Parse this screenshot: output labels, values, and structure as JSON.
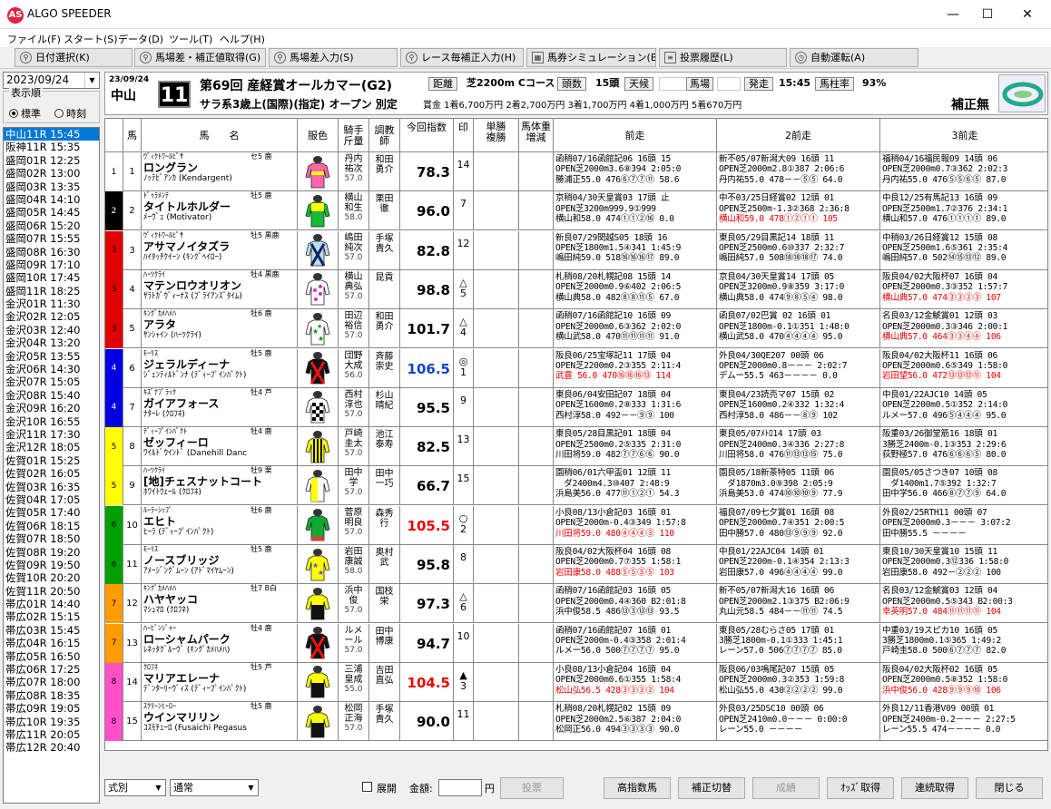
{
  "app": {
    "title": "ALGO SPEEDER",
    "icon": "AS"
  },
  "window": {
    "minimize": "—",
    "maximize": "☐",
    "close": "✕"
  },
  "menu": [
    "ファイル(F)",
    "スタート(S)",
    "データ(D)",
    "ツール(T)",
    "ヘルプ(H)"
  ],
  "toolbar": [
    {
      "label": "日付選択(K)",
      "icon": "search-icon"
    },
    {
      "label": "馬場差・補正値取得(G)",
      "icon": "search-icon"
    },
    {
      "label": "馬場差入力(S)",
      "icon": "search-icon"
    },
    {
      "label": "レース毎補正入力(H)",
      "icon": "search-icon"
    },
    {
      "label": "馬券シミュレーション(B)",
      "icon": "grid-icon"
    },
    {
      "label": "投票履歴(L)",
      "icon": "document-icon"
    },
    {
      "label": "自動運転(A)",
      "icon": "clock-icon"
    }
  ],
  "sidebar": {
    "date": "2023/09/24",
    "display_order_label": "表示順",
    "radio_standard": "標準",
    "radio_time": "時刻",
    "races": [
      "中山11R 15:45",
      "阪神11R 15:35",
      "盛岡01R 12:25",
      "盛岡02R 13:00",
      "盛岡03R 13:35",
      "盛岡04R 14:10",
      "盛岡05R 14:45",
      "盛岡06R 15:20",
      "盛岡07R 15:55",
      "盛岡08R 16:30",
      "盛岡09R 17:10",
      "盛岡10R 17:45",
      "盛岡11R 18:25",
      "金沢01R 11:30",
      "金沢02R 12:05",
      "金沢03R 12:40",
      "金沢04R 13:20",
      "金沢05R 13:55",
      "金沢06R 14:30",
      "金沢07R 15:05",
      "金沢08R 15:40",
      "金沢09R 16:20",
      "金沢10R 16:55",
      "金沢11R 17:30",
      "金沢12R 18:05",
      "佐賀01R 15:25",
      "佐賀02R 16:05",
      "佐賀03R 16:35",
      "佐賀04R 17:05",
      "佐賀05R 17:40",
      "佐賀06R 18:15",
      "佐賀07R 18:50",
      "佐賀08R 19:20",
      "佐賀09R 19:50",
      "佐賀10R 20:20",
      "佐賀11R 20:50",
      "帯広01R 14:40",
      "帯広02R 15:15",
      "帯広03R 15:45",
      "帯広04R 16:15",
      "帯広05R 16:50",
      "帯広06R 17:25",
      "帯広07R 18:00",
      "帯広08R 18:35",
      "帯広09R 19:05",
      "帯広10R 19:35",
      "帯広11R 20:05",
      "帯広12R 20:40"
    ]
  },
  "race": {
    "date": "23/09/24",
    "venue": "中山",
    "race_no": "11",
    "name": "第69回 産経賞オールカマー(G2)",
    "class": "サラ系3歳上(国際)(指定) オープン 別定",
    "dist_label": "距離",
    "dist_value": "芝2200m Cコース",
    "heads_label": "頭数",
    "heads_value": "15頭",
    "weather_label": "天候",
    "weather_value": "",
    "track_label": "馬場",
    "track_value": "",
    "post_label": "発走",
    "post_value": "15:45",
    "odds_rate_label": "馬柱率",
    "odds_rate_value": "93%",
    "prize": "賞金 1着6,700万円 2着2,700万円 3着1,700万円 4着1,000万円 5着670万円",
    "correction": "補正無"
  },
  "table_headers": {
    "uma": "馬",
    "name": "馬　　名",
    "silk": "服色",
    "jockey": "騎手\n斤量",
    "trainer": "調教\n師",
    "index": "今回指数",
    "mark": "印",
    "odds": "単勝\n複勝",
    "weight": "馬体重\n増減",
    "p1": "前走",
    "p2": "2前走",
    "p3": "3前走"
  },
  "horses": [
    {
      "waku": "1",
      "num": "1",
      "sire": "ｳﾞｨｸﾄﾜｰﾙﾋﾟｻ",
      "sex": "セ5 鹿",
      "name": "ロングラン",
      "dam": "ﾉｯﾃﾋﾞｱﾝｶ (Kendargent)",
      "jockey": "丹内\n祐次",
      "weight": "57.0",
      "trainer": "和田\n勇介",
      "index": "78.3",
      "index_color": "black",
      "mark": "",
      "mark_num": "14",
      "silk": "pink-yellow",
      "p1": [
        "函稍07/16函館記06 16頭 15",
        "OPEN芝2000m3.6⑧394 2:05:0",
        "勝浦正55.0 476⑥⑦⑦⑪ 58.6"
      ],
      "p1_red": false,
      "p2": [
        "新不05/07新潟大09 16頭 11",
        "OPEN芝2000m2.8①387 2:06:6",
        "丹内祐55.0 478－－⑤⑤ 64.0"
      ],
      "p2_red": false,
      "p3": [
        "福稍04/16福民報09 14頭 06",
        "OPEN芝2000m0.7③362 2:02:3",
        "丹内祐55.0 476⑤⑤⑥⑤ 87.0"
      ],
      "p3_red": false
    },
    {
      "waku": "2",
      "num": "2",
      "sire": "ﾄﾞｩﾗﾒﾝﾃ",
      "sex": "牡5 鹿",
      "name": "タイトルホルダー",
      "dam": "ﾒｰｳﾞｪ (Motivator)",
      "jockey": "横山\n和生",
      "weight": "58.0",
      "trainer": "栗田\n徹",
      "index": "96.0",
      "index_color": "black",
      "mark": "",
      "mark_num": "7",
      "silk": "green-yellow",
      "p1": [
        "京稍04/30天皇賞03 17頭 止",
        "OPEN芝3200m999.9①999",
        "横山和58.0 474①①②⑯ 0.0"
      ],
      "p1_red": false,
      "p2": [
        "中不03/25日経賞02 12頭 01",
        "OPEN芝2500m-1.3②368 2:36:8",
        "横山和59.0 478①②①① 105"
      ],
      "p2_red": true,
      "p3": [
        "中良12/25有馬記13 16頭 09",
        "OPEN芝2500m1.7②376 2:34:1",
        "横山和57.0 476①①①① 89.0"
      ],
      "p3_red": false
    },
    {
      "waku": "3",
      "num": "3",
      "sire": "ｳﾞｨｸﾄﾜｰﾙﾋﾟｻ",
      "sex": "牡5 黒鹿",
      "name": "アサマノイタズラ",
      "dam": "ﾊｲﾀｯﾁｸｲｰﾝ (ｷﾝｸﾞﾍｲﾛｰ)",
      "jockey": "嶋田\n純次",
      "weight": "57.0",
      "trainer": "手塚\n貴久",
      "index": "82.8",
      "index_color": "black",
      "mark": "",
      "mark_num": "12",
      "silk": "cross-blue",
      "p1": [
        "新良07/29関越S05 18頭 16",
        "OPEN芝1800m1.5④341 1:45:9",
        "嶋田純59.0 518⑯⑯⑯⑰ 89.0"
      ],
      "p1_red": false,
      "p2": [
        "東良05/29目黒記14 18頭 11",
        "OPEN芝2500m0.6⑩337 2:32:7",
        "嶋田純57.0 508⑱⑱⑱⑰ 74.0"
      ],
      "p2_red": false,
      "p3": [
        "中稍03/26日経賞12 15頭 08",
        "OPEN芝2500m1.6⑤361 2:35:4",
        "嶋田純57.0 502⑭⑮⑬⑫ 89.0"
      ],
      "p3_red": false
    },
    {
      "waku": "3",
      "num": "4",
      "sire": "ﾊｰﾂｸﾗｲ",
      "sex": "牡4 黒鹿",
      "name": "マテンロウオリオン",
      "dam": "ｻﾗﾄｶﾞｳﾞｨｰﾅｽ (ﾌﾞﾗｲｱﾝｽﾞﾀｲﾑ)",
      "jockey": "横山\n典弘",
      "weight": "57.0",
      "trainer": "昆貢",
      "index": "98.8",
      "index_color": "black",
      "mark": "△",
      "mark_num": "5",
      "silk": "pink-dots",
      "p1": [
        "札稍08/20札幌記08 15頭 14",
        "OPEN芝2000m0.9⑥402 2:06:5",
        "横山典58.0 482⑧⑧⑪⑤ 67.0"
      ],
      "p1_red": false,
      "p2": [
        "京良04/30天皇賞14 17頭 05",
        "OPEN芝3200m0.9⑧359 3:17:0",
        "横山典58.0 474⑨⑧⑤④ 98.0"
      ],
      "p2_red": false,
      "p3": [
        "阪良04/02大阪杯07 16頭 04",
        "OPEN芝2000m0.3③352 1:57:7",
        "横山典57.0 474③③③③ 107"
      ],
      "p3_red": true
    },
    {
      "waku": "3",
      "num": "5",
      "sire": "ｷﾝｸﾞｶﾒﾊﾒﾊ",
      "sex": "牡6 鹿",
      "name": "アラタ",
      "dam": "ｻﾝｼｬｲﾝ (ﾊｰﾂｸﾗｲ)",
      "jockey": "田辺\n裕信",
      "weight": "57.0",
      "trainer": "和田\n勇介",
      "index": "101.7",
      "index_color": "black",
      "mark": "△",
      "mark_num": "4",
      "silk": "green-stars",
      "p1": [
        "函稍07/16函館記10 16頭 09",
        "OPEN芝2000m0.6③362 2:02:0",
        "横山武58.0 470⑪⑪⑪⑪ 91.0"
      ],
      "p1_red": false,
      "p2": [
        "函良07/02巴賞 02 16頭 01",
        "OPEN芝1800m-0.1①351 1:48:0",
        "横山武58.0 470④④④④ 95.0"
      ],
      "p2_red": false,
      "p3": [
        "名良03/12金鯱賞01 12頭 03",
        "OPEN芝2000m0.3③346 2:00:1",
        "横山典57.0 464③③④④ 106"
      ],
      "p3_red": true
    },
    {
      "waku": "4",
      "num": "6",
      "sire": "ﾓｰﾘｽ",
      "sex": "牡5 鹿",
      "name": "ジェラルディーナ",
      "dam": "ｼﾞｪﾝﾃｨﾙﾄﾞﾝﾅ (ﾃﾞｨｰﾌﾟｲﾝﾊﾟｸﾄ)",
      "jockey": "団野\n大成",
      "weight": "56.0",
      "trainer": "斉藤\n崇史",
      "index": "106.5",
      "index_color": "blue",
      "mark": "◎",
      "mark_num": "1",
      "silk": "black-red",
      "p1": [
        "阪良06/25宝塚記11 17頭 04",
        "OPEN芝2200m0.2③355 2:11:4",
        "武豊 56.0 470⑯⑯⑯⑬ 114"
      ],
      "p1_red": true,
      "p2": [
        "外良04/30QE207 00頭 06",
        "OPEN芝2000m0.8－－－ 2:02:7",
        "デムー55.5 463－－－－ 0.0"
      ],
      "p2_red": false,
      "p3": [
        "阪良04/02大阪杯11 16頭 06",
        "OPEN芝2000m0.6⑤349 1:58:0",
        "岩田望56.0 472⑬⑬⑬⑪ 104"
      ],
      "p3_red": true
    },
    {
      "waku": "4",
      "num": "7",
      "sire": "ｷｽﾞﾅﾌﾞﾗｯｸ",
      "sex": "牡4 芦",
      "name": "ガイアフォース",
      "dam": "ﾅﾀｰﾚ (ｸﾛﾌﾈ)",
      "jockey": "西村\n淳也",
      "weight": "57.0",
      "trainer": "杉山\n晴紀",
      "index": "95.5",
      "index_color": "black",
      "mark": "",
      "mark_num": "9",
      "silk": "checker",
      "p1": [
        "東良06/04安田記07 18頭 04",
        "OPEN芝1600m0.2⑧333 1:31:6",
        "西村淳58.0 492－－⑨⑨ 100"
      ],
      "p1_red": false,
      "p2": [
        "東良04/23読売マ07 15頭 02",
        "OPEN芝1600m0.2④332 1:32:4",
        "西村淳58.0 486－－⑧⑨ 102"
      ],
      "p2_red": false,
      "p3": [
        "中良01/22AJC10 14頭 05",
        "OPEN芝2200m0.5①352 2:14:0",
        "ルメー57.0 496⑤④④④ 95.0"
      ],
      "p3_red": false
    },
    {
      "waku": "5",
      "num": "8",
      "sire": "ﾃﾞｨｰﾌﾟｲﾝﾊﾟｸﾄ",
      "sex": "牡4 鹿",
      "name": "ゼッフィーロ",
      "dam": "ﾜｲﾙﾄﾞｳｲﾝﾄﾞ (Danehill Danc",
      "jockey": "戸崎\n圭太",
      "weight": "57.0",
      "trainer": "池江\n泰寿",
      "index": "82.5",
      "index_color": "black",
      "mark": "",
      "mark_num": "13",
      "silk": "yellow-stripe",
      "p1": [
        "東良05/28目黒記01 18頭 04",
        "OPEN芝2500m0.2⑤335 2:31:0",
        "川田将59.0 482⑦⑦⑥⑥ 90.0"
      ],
      "p1_red": false,
      "p2": [
        "東良05/07ﾒﾄﾛ14 17頭 03",
        "OPEN芝2400m0.3④336 2:27:8",
        "川田将58.0 476⑪⑬⑬⑮ 75.0"
      ],
      "p2_red": false,
      "p3": [
        "阪重03/26御堂筋16 18頭 01",
        "3勝芝2400m-0.1③353 2:29:6",
        "荻野極57.0 476⑥⑥⑥⑤ 80.0"
      ],
      "p3_red": false
    },
    {
      "waku": "5",
      "num": "9",
      "sire": "ﾊｰﾂｸﾗｲ",
      "sex": "牡9 栗",
      "name": "[地]チェスナットコート",
      "dam": "ﾎﾜｲﾄｳｪｰﾙ (ｸﾛﾌﾈ)",
      "jockey": "田中\n学",
      "weight": "57.0",
      "trainer": "田中\n一巧",
      "index": "66.7",
      "index_color": "black",
      "mark": "",
      "mark_num": "15",
      "silk": "yellow-white",
      "p1": [
        "園稍06/01六甲盃01 12頭 11",
        "　ダ2400m4.3⑩407 2:48:9",
        "浜島美56.0 477⑪①②① 54.3"
      ],
      "p1_red": false,
      "p2": [
        "園良05/18新茶特05 11頭 06",
        "　ダ1870m3.0⑨398 2:05:9",
        "浜島美53.0 474⑩⑩⑩⑨ 77.9"
      ],
      "p2_red": false,
      "p3": [
        "園良05/05さつき07 10頭 08",
        "　ダ1400m1.7⑤392 1:32:7",
        "田中学56.0 466⑧⑦⑦⑨ 64.0"
      ],
      "p3_red": false
    },
    {
      "waku": "6",
      "num": "10",
      "sire": "ﾙｰﾗｰｼｯﾌﾟ",
      "sex": "牡6 鹿",
      "name": "エヒト",
      "dam": "ﾋｰﾗ (ﾃﾞｨｰﾌﾟｲﾝﾊﾟｸﾄ)",
      "jockey": "菅原\n明良",
      "weight": "57.0",
      "trainer": "森秀\n行",
      "index": "105.5",
      "index_color": "red",
      "mark": "○",
      "mark_num": "2",
      "silk": "green-plain",
      "p1": [
        "小良08/13小倉記03 16頭 01",
        "OPEN芝2000m-0.4③349 1:57:8",
        "川田将59.0 480④④④③ 110"
      ],
      "p1_red": true,
      "p2": [
        "福良07/09七夕賞01 16頭 08",
        "OPEN芝2000m0.7④351 2:00:5",
        "田中勝57.0 480⑬⑨⑨⑨ 92.0"
      ],
      "p2_red": false,
      "p3": [
        "外良02/25RTH11 00頭 07",
        "OPEN芝2000m0.3－－－ 3:07:2",
        "田中勝55.5 －－－－"
      ],
      "p3_red": false
    },
    {
      "waku": "6",
      "num": "11",
      "sire": "ﾓｰﾘｽ",
      "sex": "牡5 鹿",
      "name": "ノースブリッジ",
      "dam": "ｱﾒｰｼﾞﾝｸﾞﾑｰﾝ (ｱﾄﾞﾏｲﾔﾑｰﾝ)",
      "jockey": "岩田\n康誠",
      "weight": "58.0",
      "trainer": "奥村\n武",
      "index": "95.8",
      "index_color": "black",
      "mark": "",
      "mark_num": "8",
      "silk": "purple-yellow",
      "p1": [
        "阪良04/02大阪杯04 16頭 08",
        "OPEN芝2000m0.7⑦355 1:58:1",
        "岩田康58.0 488⑤⑤⑤⑤ 103"
      ],
      "p1_red": true,
      "p2": [
        "中良01/22AJC04 14頭 01",
        "OPEN芝2200m-0.1④354 2:13:3",
        "岩田康57.0 496④④④④ 99.0"
      ],
      "p2_red": false,
      "p3": [
        "東良10/30天皇賞10 15頭 11",
        "OPEN芝2000m0.3⑫336 1:58:0",
        "岩田康58.0 492－②②② 100"
      ],
      "p3_red": false
    },
    {
      "waku": "7",
      "num": "12",
      "sire": "ｷﾝｸﾞｶﾒﾊﾒﾊ",
      "sex": "牡7 B白",
      "name": "ハヤヤッコ",
      "dam": "ﾏｼｭﾏﾛ (ｸﾛﾌﾈ)",
      "jockey": "浜中\n俊",
      "weight": "57.0",
      "trainer": "国枝\n栄",
      "index": "97.3",
      "index_color": "black",
      "mark": "△",
      "mark_num": "6",
      "silk": "yellow-black",
      "p1": [
        "函稍07/16函館記03 16頭 05",
        "OPEN芝2000m0.4④360 B2:01:8",
        "浜中俊58.5 486⑬③⑬⑬ 93.5"
      ],
      "p1_red": false,
      "p2": [
        "新不05/07新潟大16 16頭 06",
        "OPEN芝2000m2.1③375 B2:06:9",
        "丸山元58.5 484－－⑪⑪ 74.5"
      ],
      "p2_red": false,
      "p3": [
        "名良03/12金鯱賞03 12頭 04",
        "OPEN芝2000m0.5⑤343 B2:00:3",
        "幸英明57.0 484⑪⑪⑪⑪ 104"
      ],
      "p3_red": true
    },
    {
      "waku": "7",
      "num": "13",
      "sire": "ﾊｰﾋﾞﾝｼﾞｬｰ",
      "sex": "牡4 鹿",
      "name": "ローシャムパーク",
      "dam": "ﾚﾈｯﾀｸﾞﾙｰｳﾞ (ｷﾝｸﾞｶﾒﾊﾒﾊ)",
      "jockey": "ルメ\nール",
      "weight": "57.0",
      "trainer": "田中\n博康",
      "index": "94.7",
      "index_color": "black",
      "mark": "",
      "mark_num": "10",
      "silk": "black-red",
      "p1": [
        "函稍07/16函館記07 16頭 01",
        "OPEN芝2000m-0.4③358 2:01:4",
        "ルメー56.0 500⑦⑦⑦⑦ 95.0"
      ],
      "p1_red": false,
      "p2": [
        "東良05/28むらさ05 17頭 01",
        "3勝芝1800m-0.1①333 1:45:1",
        "レーン57.0 506⑦⑦⑦⑦ 85.0"
      ],
      "p2_red": false,
      "p3": [
        "中重03/19スピカ10 16頭 05",
        "3勝芝1800m0.1⑤365 1:49:2",
        "戸崎圭58.0 500⑥⑦⑦⑦ 82.0"
      ],
      "p3_red": false
    },
    {
      "waku": "8",
      "num": "14",
      "sire": "ｸﾛﾌﾈ",
      "sex": "牡5 芦",
      "name": "マリアエレーナ",
      "dam": "ﾃﾞﾝﾀｰﾘｰｳﾞｨｽ (ﾃﾞｨｰﾌﾟｲﾝﾊﾟｸﾄ)",
      "jockey": "三浦\n皇成",
      "weight": "55.0",
      "trainer": "吉田\n直弘",
      "index": "104.5",
      "index_color": "red",
      "mark": "▲",
      "mark_num": "3",
      "silk": "yellow-black",
      "p1": [
        "小良08/13小倉記04 16頭 04",
        "OPEN芝2000m0.6①355 1:58:4",
        "松山弘56.5 428③③③② 104"
      ],
      "p1_red": true,
      "p2": [
        "阪良06/03鳴尾記07 15頭 05",
        "OPEN芝2000m0.3②353 1:59:8",
        "松山弘55.0 430②②②② 99.0"
      ],
      "p2_red": false,
      "p3": [
        "阪良04/02大阪杯02 16頭 05",
        "OPEN芝2000m0.5⑧352 1:58:0",
        "浜中俊56.0 428⑨⑨⑨⑩ 106"
      ],
      "p3_red": true
    },
    {
      "waku": "8",
      "num": "15",
      "sire": "ｽｸﾘｰﾝﾋｰﾛｰ",
      "sex": "牡5 鹿",
      "name": "ウインマリリン",
      "dam": "ｺｽﾓﾁｪｰﾛ (Fusaichi Pegasus",
      "jockey": "松岡\n正海",
      "weight": "57.0",
      "trainer": "手塚\n貴久",
      "index": "90.0",
      "index_color": "black",
      "mark": "",
      "mark_num": "11",
      "silk": "yellow-black",
      "p1": [
        "札稍08/20札幌記02 15頭 09",
        "OPEN芝2000m2.5⑥387 2:04:0",
        "松岡正56.0 494③③③③ 90.0"
      ],
      "p1_red": false,
      "p2": [
        "外良03/25DSC10 00頭 06",
        "OPEN芝2410m0.0－－－ 0:00:0",
        "レーン55.0 －－－－"
      ],
      "p2_red": false,
      "p3": [
        "外良12/11香港V09 00頭 01",
        "OPEN芝2400m-0.2－－－ 2:27:5",
        "レーン55.5 474－－－－ 0.0"
      ],
      "p3_red": false
    }
  ],
  "waku_colors": {
    "1": "#ffffff",
    "2": "#000000",
    "3": "#e00000",
    "4": "#0000e0",
    "5": "#ffff00",
    "6": "#00a000",
    "7": "#ff9c00",
    "8": "#ff50c8"
  },
  "bottom": {
    "bet_type": "式別",
    "bet_mode": "通常",
    "expand_label": "展開",
    "amount_label": "金額:",
    "amount_unit": "円",
    "vote": "投票",
    "high_index": "高指数馬",
    "toggle_correction": "補正切替",
    "result": "成績",
    "get_odds": "ｵｯｽﾞ取得",
    "continuous": "連続取得",
    "close": "閉じる"
  }
}
